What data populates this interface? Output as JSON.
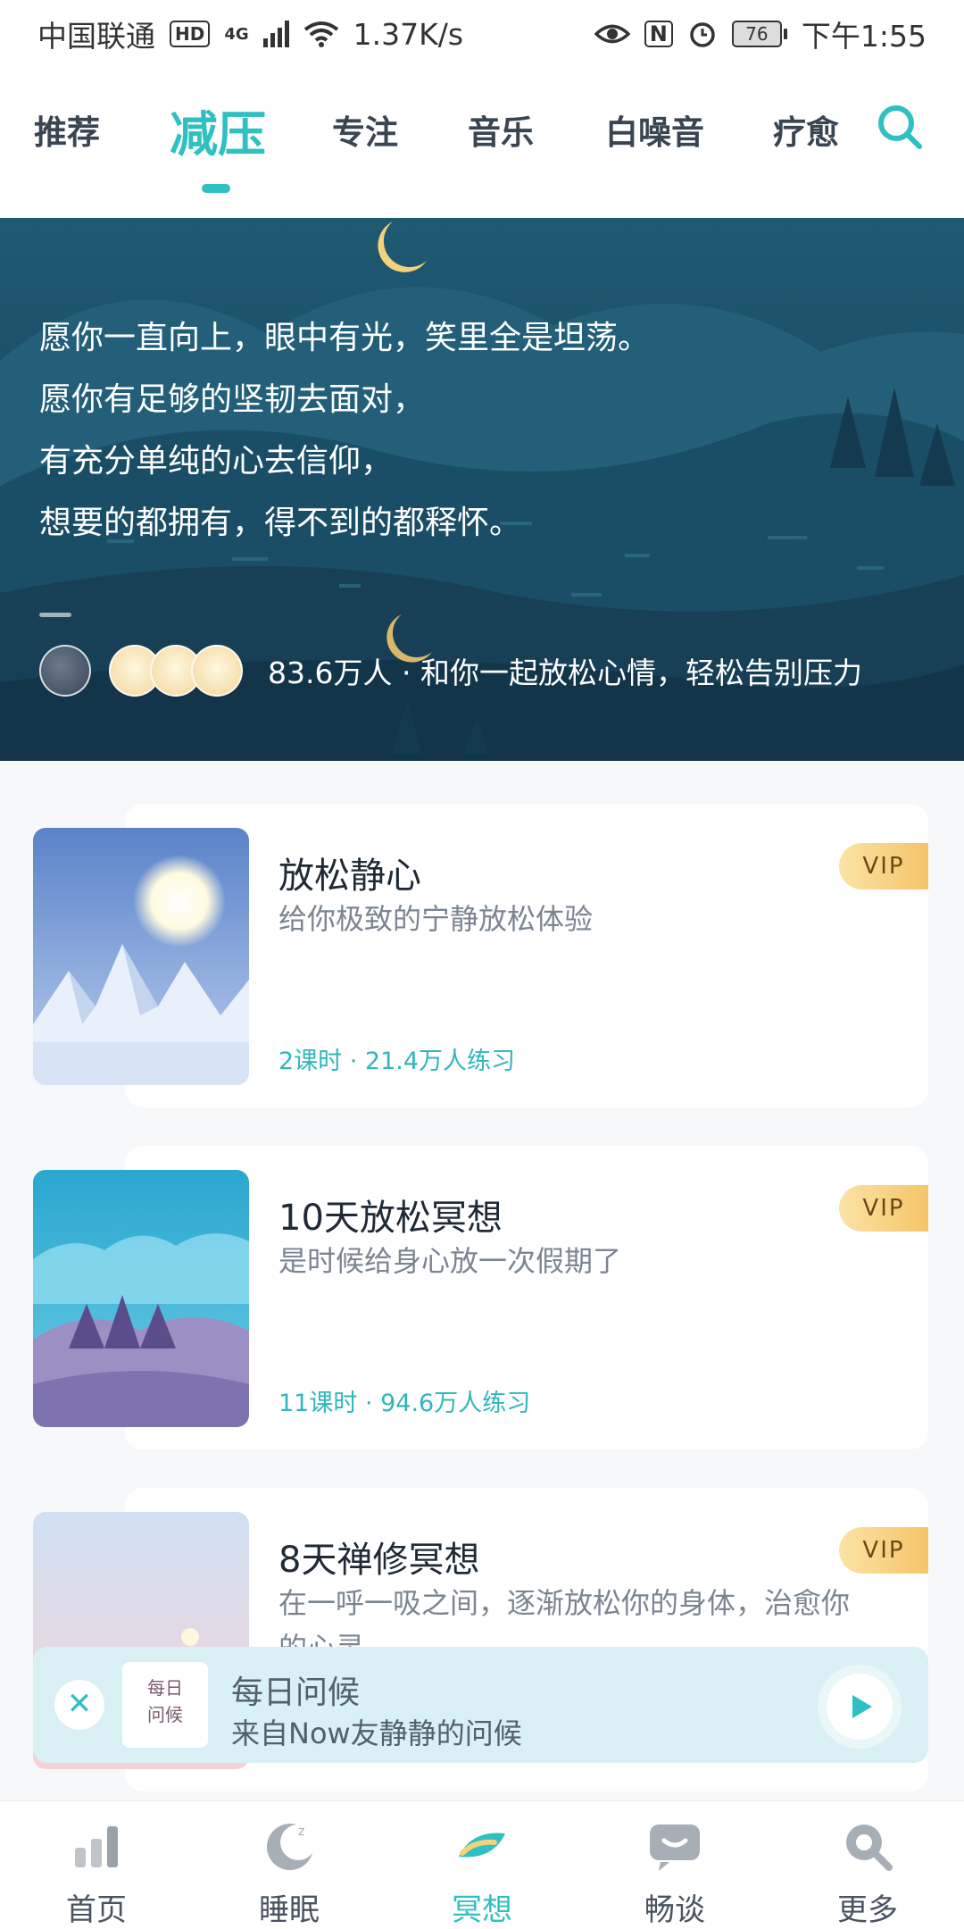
{
  "status_bar": {
    "carrier": "中国联通",
    "hd": "HD",
    "net": "4G",
    "speed": "1.37K/s",
    "nfc": "N",
    "battery": "76",
    "time": "下午1:55"
  },
  "tabs": [
    {
      "label": "推荐",
      "active": false
    },
    {
      "label": "减压",
      "active": true
    },
    {
      "label": "专注",
      "active": false
    },
    {
      "label": "音乐",
      "active": false
    },
    {
      "label": "白噪音",
      "active": false
    },
    {
      "label": "疗愈",
      "active": false
    }
  ],
  "banner": {
    "lines": [
      "愿你一直向上，眼中有光，笑里全是坦荡。",
      "愿你有足够的坚韧去面对，",
      "有充分单纯的心去信仰，",
      "想要的都拥有，得不到的都释怀。"
    ],
    "count_text": "83.6万人 · 和你一起放松心情，轻松告别压力"
  },
  "courses": [
    {
      "title": "放松静心",
      "desc": "给你极致的宁静放松体验",
      "meta": "2课时 · 21.4万人练习",
      "badge": "VIP"
    },
    {
      "title": "10天放松冥想",
      "desc": "是时候给身心放一次假期了",
      "meta": "11课时 · 94.6万人练习",
      "badge": "VIP"
    },
    {
      "title": "8天禅修冥想",
      "desc": "在一呼一吸之间，逐渐放松你的身体，治愈你的心灵",
      "meta": "",
      "badge": "VIP"
    }
  ],
  "player": {
    "close_symbol": "✕",
    "thumb_text_1": "每日",
    "thumb_text_2": "问候",
    "title": "每日问候",
    "subtitle": "来自Now友静静的问候"
  },
  "bottom_nav": [
    {
      "label": "首页",
      "active": false
    },
    {
      "label": "睡眠",
      "active": false
    },
    {
      "label": "冥想",
      "active": true
    },
    {
      "label": "畅谈",
      "active": false
    },
    {
      "label": "更多",
      "active": false
    }
  ],
  "colors": {
    "accent": "#2fc0c3",
    "vip_gold": "#f5c468"
  }
}
